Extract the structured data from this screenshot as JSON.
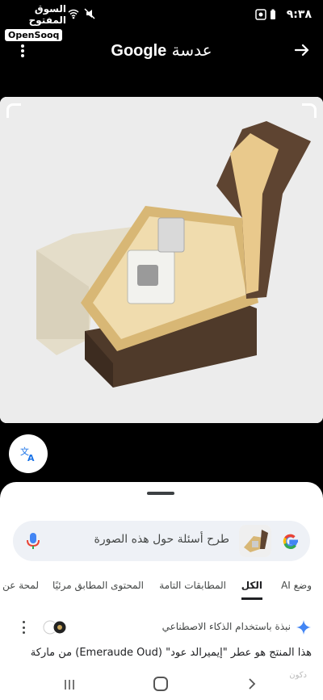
{
  "status_bar": {
    "time": "٩:٣٨",
    "watermark_arabic": "السوق المفتوح",
    "watermark_brand": "OpenSooq"
  },
  "app_bar": {
    "brand": "Google",
    "title_suffix": "عدسة",
    "menu_icon": "more-vert-icon",
    "forward_icon": "arrow-forward-icon"
  },
  "search": {
    "placeholder": "طرح أسئلة حول هذه الصورة",
    "mic_icon": "mic-icon",
    "logo_icon": "google-g-icon"
  },
  "tabs": [
    {
      "label": "وضع AI",
      "active": false
    },
    {
      "label": "الكل",
      "active": true
    },
    {
      "label": "المطابقات التامة",
      "active": false
    },
    {
      "label": "المحتوى المطابق مرئيًا",
      "active": false
    },
    {
      "label": "لمحة عن",
      "active": false
    }
  ],
  "ai_overview": {
    "label": "نبذة باستخدام الذكاء الاصطناعي",
    "snippet": "هذا المنتج هو عطر \"إيميرالد عود\" (Emeraude Oud) من ماركة"
  },
  "nav": {
    "faded_label": "دكون"
  },
  "colors": {
    "background": "#000000",
    "sheet": "#ffffff",
    "search_bg": "#eef1f6",
    "box_brown": "#5b4330",
    "box_gold": "#e7c98a"
  }
}
